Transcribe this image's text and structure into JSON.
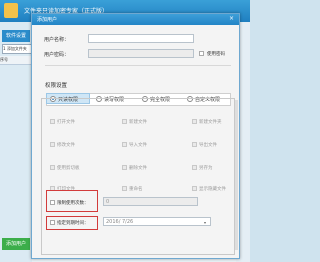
{
  "app": {
    "title": "文件夹只读加密专家（正式版）",
    "side_tab": "软件设置",
    "sub_tab": "1 添加文件夹",
    "column": "序号",
    "add_button": "添加用户"
  },
  "dialog": {
    "title": "添加用户",
    "close": "×",
    "username_label": "用户名称：",
    "username_value": "",
    "password_label": "用户密码：",
    "password_value": "",
    "use_password_label": "使用密码",
    "permissions_title": "权限设置",
    "radios": [
      {
        "label": "只读权限",
        "selected": true
      },
      {
        "label": "读写权限",
        "selected": false
      },
      {
        "label": "完全权限",
        "selected": false
      },
      {
        "label": "自定义权限",
        "selected": false
      }
    ],
    "checkboxes": [
      [
        "打开文件",
        "新建文件",
        "新建文件夹"
      ],
      [
        "修改文件",
        "导入文件",
        "导出文件"
      ],
      [
        "使用剪切板",
        "删除文件",
        "另存为"
      ],
      [
        "打印文件",
        "重命名",
        "显示隐藏文件"
      ]
    ],
    "limit_uses_label": "限制使用次数：",
    "limit_uses_value": "0",
    "expiry_label": "指定到期时间：",
    "expiry_value": "2016/ 7/26"
  }
}
